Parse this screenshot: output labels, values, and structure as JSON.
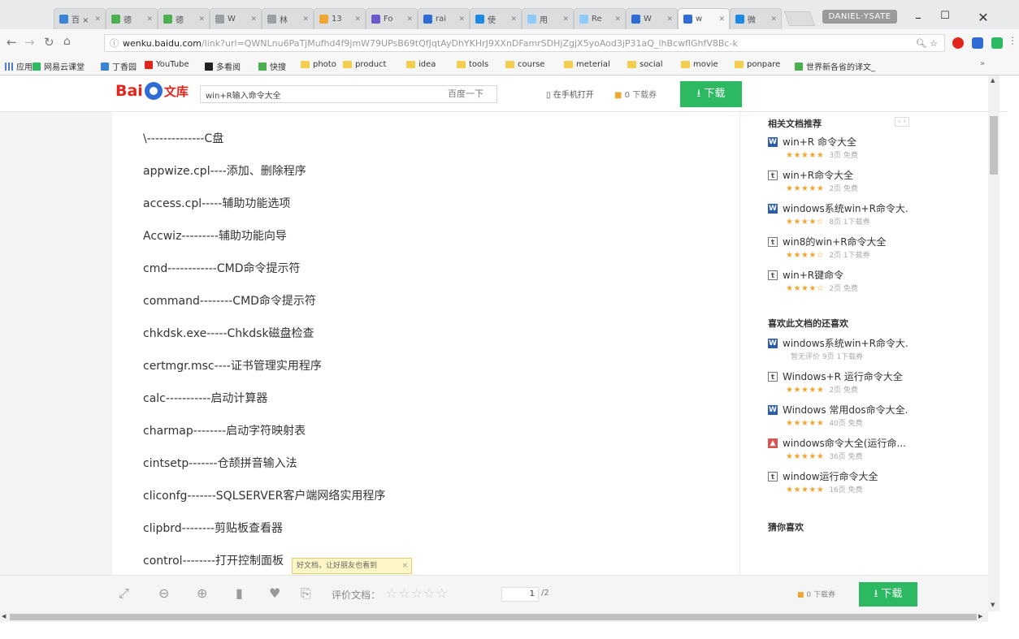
{
  "browser": {
    "tabs": [
      {
        "label": "百 ×",
        "color": "#3c84d6"
      },
      {
        "label": "德",
        "color": "#4caf50"
      },
      {
        "label": "德",
        "color": "#4caf50"
      },
      {
        "label": "W",
        "color": "#9aa0a6"
      },
      {
        "label": "林",
        "color": "#9aa0a6"
      },
      {
        "label": "13",
        "color": "#f0a630"
      },
      {
        "label": "Fo",
        "color": "#6a5acd"
      },
      {
        "label": "rai",
        "color": "#2f6cd4"
      },
      {
        "label": "使",
        "color": "#1e88e5"
      },
      {
        "label": "用",
        "color": "#90caf9"
      },
      {
        "label": "Re",
        "color": "#90caf9"
      },
      {
        "label": "W",
        "color": "#2f6cd4"
      },
      {
        "label": "w",
        "color": "#2f6cd4"
      },
      {
        "label": "微",
        "color": "#1e88e5"
      }
    ],
    "profile_label": "DANIEL·YSATE",
    "url_host": "wenku.baidu.com",
    "url_rest": "/link?url=QWNLnu6PaTjMufhd4f9jmW79UPsB69tQfJqtAyDhYKHrJ9XXnDFamrSDHjZgjX5yoAod3jP31aQ_lhBcwflGhfV8Bc-k",
    "bookmarks": [
      {
        "label": "应用",
        "type": "apps"
      },
      {
        "label": "网易云课堂",
        "type": "site",
        "color": "#2db862"
      },
      {
        "label": "丁香园",
        "type": "site",
        "color": "#3c84d6"
      },
      {
        "label": "YouTube",
        "type": "site",
        "color": "#e1241c"
      },
      {
        "label": "多看阅",
        "type": "site",
        "color": "#222222"
      },
      {
        "label": "快搜",
        "type": "site",
        "color": "#4caf50"
      },
      {
        "label": "photo",
        "type": "folder"
      },
      {
        "label": "product",
        "type": "folder"
      },
      {
        "label": "idea",
        "type": "folder"
      },
      {
        "label": "tools",
        "type": "folder"
      },
      {
        "label": "course",
        "type": "folder"
      },
      {
        "label": "meterial",
        "type": "folder"
      },
      {
        "label": "social",
        "type": "folder"
      },
      {
        "label": "movie",
        "type": "folder"
      },
      {
        "label": "ponpare",
        "type": "folder"
      },
      {
        "label": "世界新各省的译文_",
        "type": "site",
        "color": "#4caf50"
      }
    ]
  },
  "header": {
    "logo_bai": "Bai",
    "logo_wenku": "文库",
    "search_value": "win+R输入命令大全",
    "search_button": "百度一下",
    "mobile_open": "在手机打开",
    "coupon": "0 下载券",
    "download": "下载"
  },
  "document": {
    "lines": [
      "\\--------------C盘",
      "appwize.cpl----添加、删除程序",
      "access.cpl-----辅助功能选项",
      "Accwiz---------辅助功能向导",
      "cmd------------CMD命令提示符",
      "command--------CMD命令提示符",
      "chkdsk.exe-----Chkdsk磁盘检查",
      "certmgr.msc----证书管理实用程序",
      "calc-----------启动计算器",
      "charmap--------启动字符映射表",
      "cintsetp-------仓颉拼音输入法",
      "cliconfg-------SQLSERVER客户端网络实用程序",
      "clipbrd--------剪贴板查看器",
      "control--------打开控制面板"
    ],
    "share_tip": "好文档，让好朋友也看到",
    "share_tip_close": "×"
  },
  "sidebar": {
    "related_title": "相关文档推荐",
    "related": [
      {
        "icon": "word",
        "title": "win+R 命令大全",
        "stars": "★★★★★",
        "meta": "3页   免费"
      },
      {
        "icon": "txt",
        "title": "win+R命令大全",
        "stars": "★★★★★",
        "meta": "2页   免费"
      },
      {
        "icon": "word",
        "title": "windows系统win+R命令大.",
        "stars": "★★★★☆",
        "meta": "8页   1下载券"
      },
      {
        "icon": "txt",
        "title": "win8的win+R命令大全",
        "stars": "★★★★☆",
        "meta": "2页   1下载券"
      },
      {
        "icon": "txt",
        "title": "win+R键命令",
        "stars": "★★★★☆",
        "meta": "2页   免费"
      }
    ],
    "liked_title": "喜欢此文档的还喜欢",
    "liked": [
      {
        "icon": "word",
        "title": "windows系统win+R命令大.",
        "stars": "",
        "meta": "暂无评价   9页   1下载券"
      },
      {
        "icon": "txt",
        "title": "Windows+R 运行命令大全",
        "stars": "★★★★★",
        "meta": "2页   免费"
      },
      {
        "icon": "word",
        "title": "Windows 常用dos命令大全.",
        "stars": "★★★★★",
        "meta": "40页   免费"
      },
      {
        "icon": "pdf",
        "title": "windows命令大全(运行命...",
        "stars": "★★★★★",
        "meta": "36页   免费"
      },
      {
        "icon": "txt",
        "title": "window运行命令大全",
        "stars": "★★★★★",
        "meta": "16页   免费"
      }
    ],
    "guess_title": "猜你喜欢"
  },
  "bottom_bar": {
    "rate_label": "评价文档：",
    "rate_stars": "☆☆☆☆☆",
    "page_current": "1",
    "page_total": "/2",
    "coupon": "0 下载券",
    "download": "下载"
  }
}
